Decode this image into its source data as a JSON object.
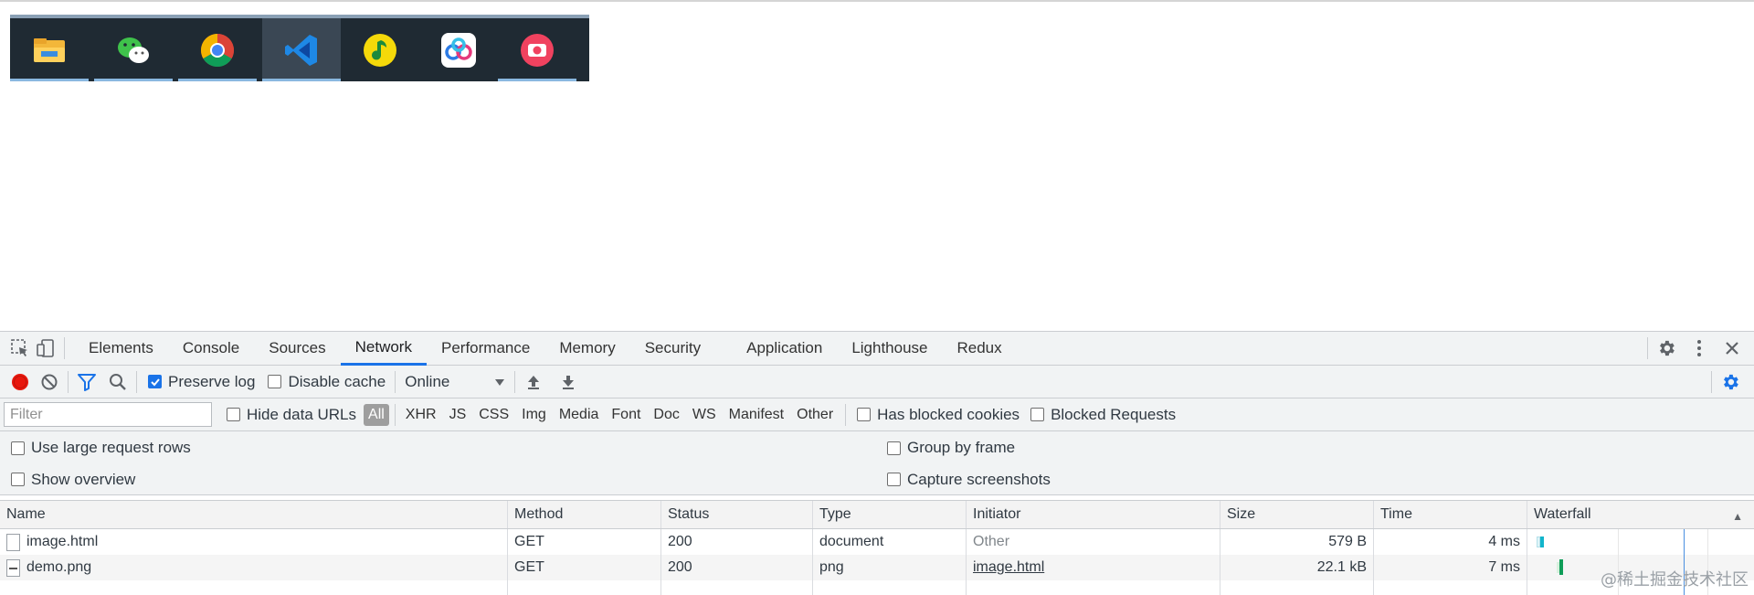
{
  "taskbar": {
    "apps": [
      {
        "name": "file-explorer",
        "active": false
      },
      {
        "name": "wechat",
        "active": false
      },
      {
        "name": "chrome",
        "active": false
      },
      {
        "name": "vscode",
        "active": true
      },
      {
        "name": "qq-music",
        "active": false
      },
      {
        "name": "baidu-netdisk",
        "active": false
      },
      {
        "name": "screenshot-tool",
        "active": false
      }
    ]
  },
  "devtools": {
    "tabs": [
      "Elements",
      "Console",
      "Sources",
      "Network",
      "Performance",
      "Memory",
      "Security",
      "Application",
      "Lighthouse",
      "Redux"
    ],
    "active_tab": "Network",
    "toolbar": {
      "preserve_log": "Preserve log",
      "disable_cache": "Disable cache",
      "throttle": "Online"
    },
    "filter": {
      "placeholder": "Filter",
      "hide_data_urls": "Hide data URLs",
      "types": [
        "All",
        "XHR",
        "JS",
        "CSS",
        "Img",
        "Media",
        "Font",
        "Doc",
        "WS",
        "Manifest",
        "Other"
      ],
      "has_blocked_cookies": "Has blocked cookies",
      "blocked_requests": "Blocked Requests"
    },
    "settings": {
      "large_rows": "Use large request rows",
      "group_by_frame": "Group by frame",
      "show_overview": "Show overview",
      "capture_screenshots": "Capture screenshots"
    },
    "table": {
      "headers": {
        "name": "Name",
        "method": "Method",
        "status": "Status",
        "type": "Type",
        "initiator": "Initiator",
        "size": "Size",
        "time": "Time",
        "waterfall": "Waterfall"
      },
      "rows": [
        {
          "name": "image.html",
          "method": "GET",
          "status": "200",
          "type": "document",
          "initiator": "Other",
          "size": "579 B",
          "time": "4 ms"
        },
        {
          "name": "demo.png",
          "method": "GET",
          "status": "200",
          "type": "png",
          "initiator": "image.html",
          "size": "22.1 kB",
          "time": "7 ms"
        }
      ]
    }
  },
  "watermark": "@稀土掘金技术社区",
  "colors": {
    "record": "#e8170d",
    "accent": "#1a73e8",
    "waterfall_doc": "#12b5cb",
    "waterfall_img": "#0f9d58"
  }
}
